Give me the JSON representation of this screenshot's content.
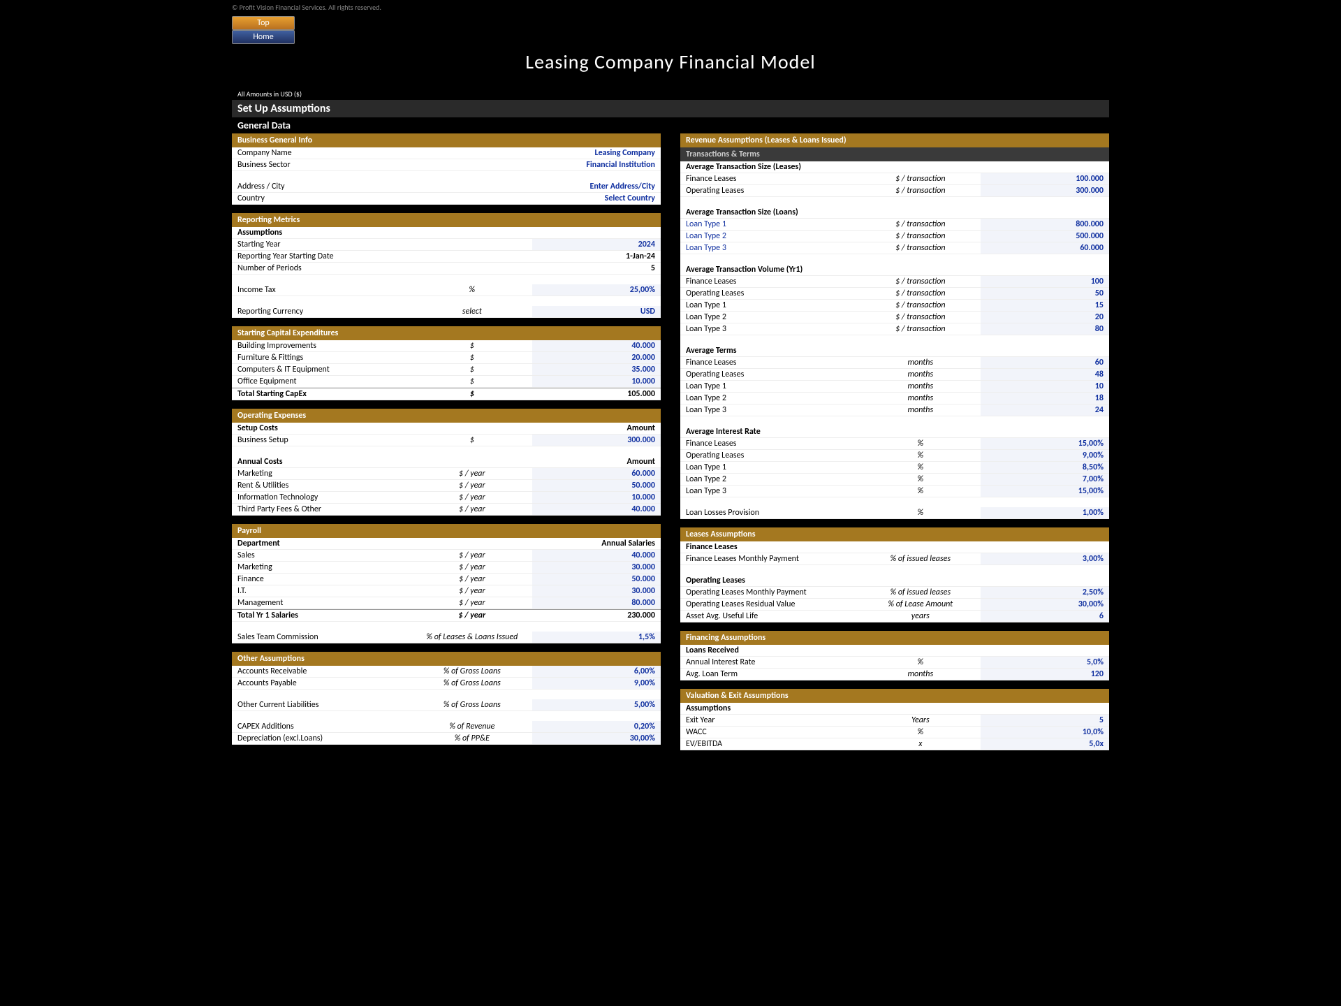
{
  "copyright": "© Profit Vision Financial Services. All rights reserved.",
  "topBtn": "Top",
  "homeBtn": "Home",
  "title": "Leasing Company Financial Model",
  "note": "All Amounts in  USD ($)",
  "h1": "Set Up Assumptions",
  "h2": "General Data",
  "left": {
    "bgi": {
      "hdr": "Business General Info",
      "company_l": "Company Name",
      "company_v": "Leasing Company",
      "sector_l": "Business Sector",
      "sector_v": "Financial Institution",
      "addr_l": "Address / City",
      "addr_v": "Enter Address/City",
      "country_l": "Country",
      "country_v": "Select Country"
    },
    "rm": {
      "hdr": "Reporting Metrics",
      "assump": "Assumptions",
      "sy_l": "Starting Year",
      "sy_v": "2024",
      "rysd_l": "Reporting Year Starting Date",
      "rysd_v": "1-Jan-24",
      "np_l": "Number of Periods",
      "np_v": "5",
      "tax_l": "Income Tax",
      "tax_u": "%",
      "tax_v": "25,00%",
      "curr_l": "Reporting Currency",
      "curr_u": "select",
      "curr_v": "USD"
    },
    "sce": {
      "hdr": "Starting Capital Expenditures",
      "r1_l": "Building Improvements",
      "r1_u": "$",
      "r1_v": "40.000",
      "r2_l": "Furniture & Fittings",
      "r2_u": "$",
      "r2_v": "20.000",
      "r3_l": "Computers & IT Equipment",
      "r3_u": "$",
      "r3_v": "35.000",
      "r4_l": "Office Equipment",
      "r4_u": "$",
      "r4_v": "10.000",
      "tot_l": "Total Starting CapEx",
      "tot_u": "$",
      "tot_v": "105.000"
    },
    "oe": {
      "hdr": "Operating Expenses",
      "setup_h": "Setup Costs",
      "amount": "Amount",
      "bs_l": "Business Setup",
      "bs_u": "$",
      "bs_v": "300.000",
      "annual_h": "Annual Costs",
      "mk_l": "Marketing",
      "mk_u": "$ / year",
      "mk_v": "60.000",
      "ru_l": "Rent & Utilities",
      "ru_u": "$ / year",
      "ru_v": "50.000",
      "it_l": "Information Technology",
      "it_u": "$ / year",
      "it_v": "10.000",
      "tp_l": "Third Party Fees & Other",
      "tp_u": "$ / year",
      "tp_v": "40.000"
    },
    "pr": {
      "hdr": "Payroll",
      "dept": "Department",
      "sal": "Annual Salaries",
      "sa_l": "Sales",
      "sa_u": "$ / year",
      "sa_v": "40.000",
      "ma_l": "Marketing",
      "ma_u": "$ / year",
      "ma_v": "30.000",
      "fi_l": "Finance",
      "fi_u": "$ / year",
      "fi_v": "50.000",
      "it_l": "I.T.",
      "it_u": "$ / year",
      "it_v": "30.000",
      "mg_l": "Management",
      "mg_u": "$ / year",
      "mg_v": "80.000",
      "tot_l": "Total Yr 1 Salaries",
      "tot_u": "$ / year",
      "tot_v": "230.000",
      "stc_l": "Sales Team Commission",
      "stc_u": "% of Leases & Loans Issued",
      "stc_v": "1,5%"
    },
    "oa": {
      "hdr": "Other Assumptions",
      "ar_l": "Accounts Receivable",
      "ar_u": "% of Gross Loans",
      "ar_v": "6,00%",
      "ap_l": "Accounts Payable",
      "ap_u": "% of Gross Loans",
      "ap_v": "9,00%",
      "ocl_l": "Other Current Liabilities",
      "ocl_u": "% of Gross Loans",
      "ocl_v": "5,00%",
      "ca_l": "CAPEX Additions",
      "ca_u": "% of Revenue",
      "ca_v": "0,20%",
      "de_l": "Depreciation (excl.Loans)",
      "de_u": "% of PP&E",
      "de_v": "30,00%"
    }
  },
  "right": {
    "rev": {
      "hdr": "Revenue Assumptions (Leases & Loans Issued)",
      "tt": "Transactions & Terms",
      "ats_leases": "Average Transaction Size (Leases)",
      "fl_l": "Finance Leases",
      "pertx": "$ / transaction",
      "fl_v": "100.000",
      "ol_l": "Operating Leases",
      "ol_v": "300.000",
      "ats_loans": "Average Transaction Size (Loans)",
      "lt1": "Loan Type 1",
      "lt1_v": "800.000",
      "lt2": "Loan Type 2",
      "lt2_v": "500.000",
      "lt3": "Loan Type 3",
      "lt3_v": "60.000",
      "atv": "Average Transaction Volume (Yr1)",
      "atv_fl": "100",
      "atv_ol": "50",
      "atv_l1": "15",
      "atv_l2": "20",
      "atv_l3": "80",
      "at": "Average Terms",
      "months": "months",
      "at_fl": "60",
      "at_ol": "48",
      "at_l1": "10",
      "at_l2": "18",
      "at_l3": "24",
      "air": "Average Interest Rate",
      "pct": "%",
      "air_fl": "15,00%",
      "air_ol": "9,00%",
      "air_l1": "8,50%",
      "air_l2": "7,00%",
      "air_l3": "15,00%",
      "llp_l": "Loan Losses Provision",
      "llp_v": "1,00%"
    },
    "la": {
      "hdr": "Leases Assumptions",
      "fl_h": "Finance Leases",
      "flmp_l": "Finance Leases Monthly Payment",
      "flmp_u": "% of issued leases",
      "flmp_v": "3,00%",
      "ol_h": "Operating Leases",
      "olmp_l": "Operating Leases Monthly Payment",
      "olmp_u": "% of issued leases",
      "olmp_v": "2,50%",
      "olrv_l": "Operating Leases Residual Value",
      "olrv_u": "% of Lease Amount",
      "olrv_v": "30,00%",
      "aul_l": "Asset Avg. Useful Life",
      "aul_u": "years",
      "aul_v": "6"
    },
    "fa": {
      "hdr": "Financing Assumptions",
      "lr": "Loans Received",
      "air_l": "Annual Interest Rate",
      "air_u": "%",
      "air_v": "5,0%",
      "alt_l": "Avg. Loan Term",
      "alt_u": "months",
      "alt_v": "120"
    },
    "ve": {
      "hdr": "Valuation & Exit Assumptions",
      "assump": "Assumptions",
      "ey_l": "Exit Year",
      "ey_u": "Years",
      "ey_v": "5",
      "wa_l": "WACC",
      "wa_u": "%",
      "wa_v": "10,0%",
      "ev_l": "EV/EBITDA",
      "ev_u": "x",
      "ev_v": "5,0x"
    }
  }
}
